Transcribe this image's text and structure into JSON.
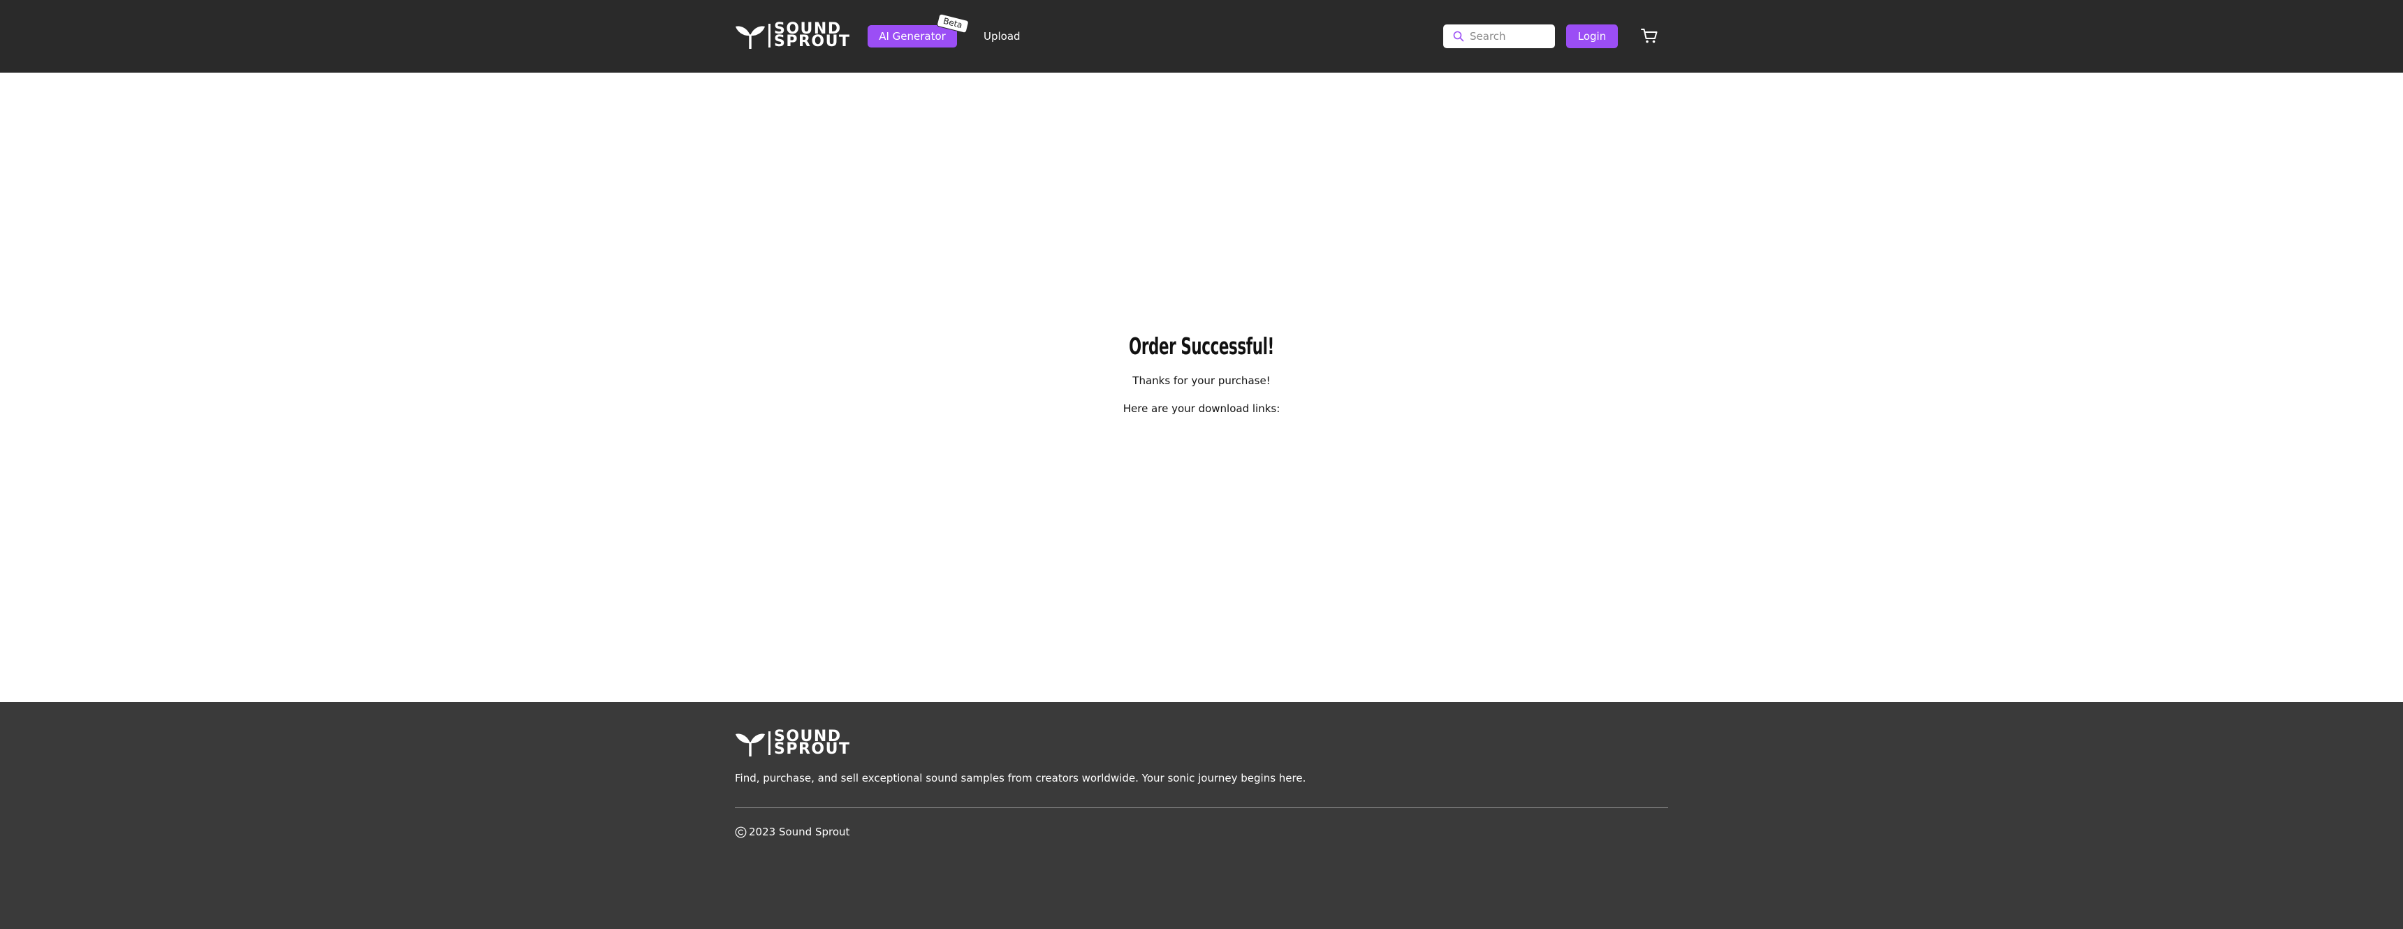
{
  "header": {
    "brand": {
      "line1": "SOUND",
      "line2": "SPROUT"
    },
    "ai_generator_label": "AI Generator",
    "beta_label": "Beta",
    "upload_label": "Upload",
    "search_placeholder": "Search",
    "login_label": "Login",
    "icons": {
      "search": "search-icon",
      "cart": "cart-icon",
      "logo": "sprout-icon"
    }
  },
  "main": {
    "title": "Order Successful!",
    "thanks": "Thanks for your purchase!",
    "download": "Here are your download links:"
  },
  "footer": {
    "brand": {
      "line1": "SOUND",
      "line2": "SPROUT"
    },
    "tagline": "Find, purchase, and sell exceptional sound samples from creators worldwide. Your sonic journey begins here.",
    "copyright": "2023 Sound Sprout"
  },
  "colors": {
    "header_bg": "#2a2a2a",
    "footer_bg": "#3a3a3a",
    "accent": "#9b4ef5",
    "text_dark": "#111111",
    "text_light": "#ffffff"
  }
}
